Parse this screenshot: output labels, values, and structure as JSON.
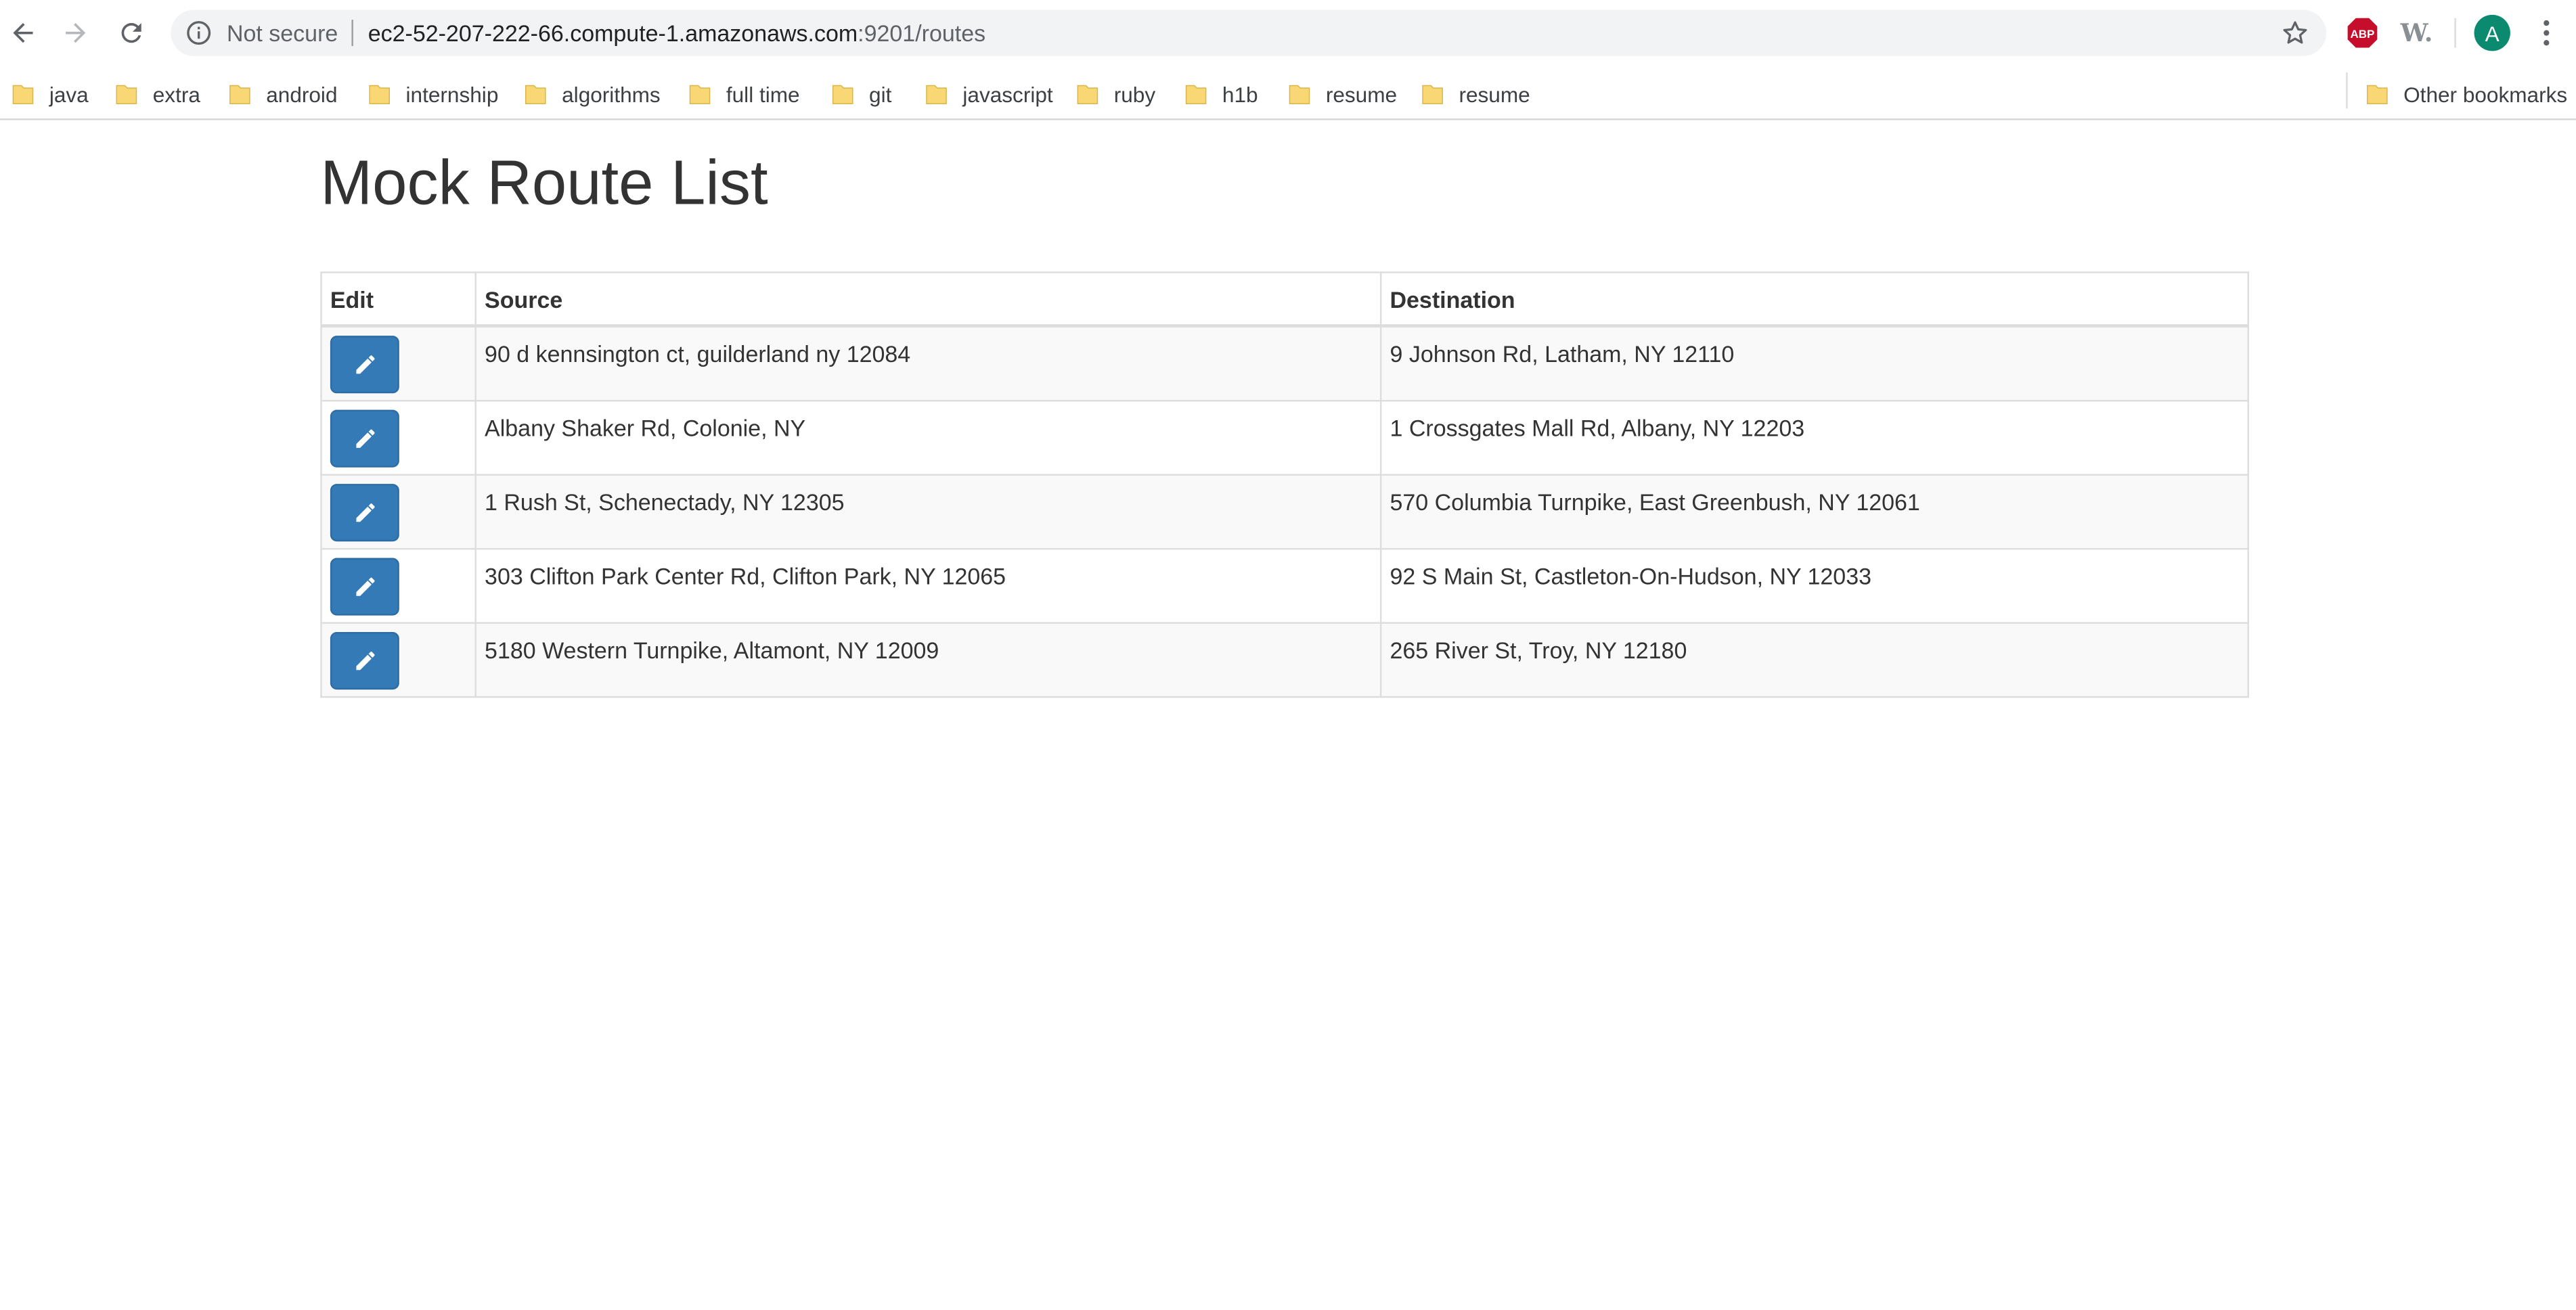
{
  "browser": {
    "security_label": "Not secure",
    "url_host": "ec2-52-207-222-66.compute-1.amazonaws.com",
    "url_rest": ":9201/routes",
    "avatar_initial": "A",
    "extensions": [
      "adblock-plus-icon",
      "w-extension-icon"
    ],
    "avatar_color": "#0b8a6f"
  },
  "bookmarks": {
    "items": [
      {
        "label": "java"
      },
      {
        "label": "extra"
      },
      {
        "label": "android"
      },
      {
        "label": "internship"
      },
      {
        "label": "algorithms"
      },
      {
        "label": "full time"
      },
      {
        "label": "git"
      },
      {
        "label": "javascript"
      },
      {
        "label": "ruby"
      },
      {
        "label": "h1b"
      },
      {
        "label": "resume"
      },
      {
        "label": "resume"
      }
    ],
    "other_label": "Other bookmarks",
    "folder_color": "#f9d774"
  },
  "page": {
    "title": "Mock Route List",
    "table": {
      "headers": {
        "edit": "Edit",
        "source": "Source",
        "destination": "Destination"
      },
      "rows": [
        {
          "source": "90 d kennsington ct, guilderland ny 12084",
          "destination": "9 Johnson Rd, Latham, NY 12110"
        },
        {
          "source": "Albany Shaker Rd, Colonie, NY",
          "destination": "1 Crossgates Mall Rd, Albany, NY 12203"
        },
        {
          "source": "1 Rush St, Schenectady, NY 12305",
          "destination": "570 Columbia Turnpike, East Greenbush, NY 12061"
        },
        {
          "source": "303 Clifton Park Center Rd, Clifton Park, NY 12065",
          "destination": "92 S Main St, Castleton-On-Hudson, NY 12033"
        },
        {
          "source": "5180 Western Turnpike, Altamont, NY 12009",
          "destination": "265 River St, Troy, NY 12180"
        }
      ]
    },
    "edit_button_color": "#337ab7"
  }
}
